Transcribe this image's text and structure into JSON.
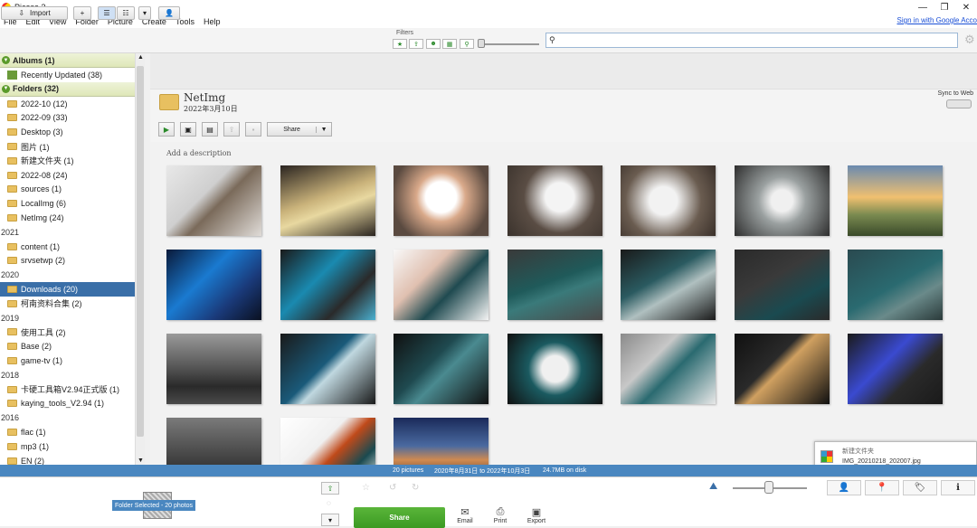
{
  "window": {
    "title": "Picasa 3",
    "controls": [
      "—",
      "❐",
      "✕"
    ]
  },
  "menu": [
    "File",
    "Edit",
    "View",
    "Folder",
    "Picture",
    "Create",
    "Tools",
    "Help"
  ],
  "signin": "Sign in with Google Acco",
  "toolbar": {
    "import_label": "Import",
    "filters_label": "Filters"
  },
  "sidebar": {
    "albums_header": "Albums (1)",
    "albums": [
      {
        "label": "Recently Updated (38)"
      }
    ],
    "folders_header": "Folders (32)",
    "entries": [
      {
        "type": "folder",
        "label": "2022-10 (12)"
      },
      {
        "type": "folder",
        "label": "2022-09 (33)"
      },
      {
        "type": "folder",
        "label": "Desktop (3)"
      },
      {
        "type": "folder",
        "label": "图片 (1)"
      },
      {
        "type": "folder",
        "label": "新建文件夹 (1)"
      },
      {
        "type": "folder",
        "label": "2022-08 (24)"
      },
      {
        "type": "folder",
        "label": "sources (1)"
      },
      {
        "type": "folder",
        "label": "LocalImg (6)"
      },
      {
        "type": "folder",
        "label": "NetImg (24)"
      },
      {
        "type": "year",
        "label": "2021"
      },
      {
        "type": "folder",
        "label": "content (1)"
      },
      {
        "type": "folder",
        "label": "srvsetwp (2)"
      },
      {
        "type": "year",
        "label": "2020"
      },
      {
        "type": "folder",
        "label": "Downloads (20)",
        "selected": true
      },
      {
        "type": "folder",
        "label": "柯南资料合集 (2)"
      },
      {
        "type": "year",
        "label": "2019"
      },
      {
        "type": "folder",
        "label": "使用工具 (2)"
      },
      {
        "type": "folder",
        "label": "Base (2)"
      },
      {
        "type": "folder",
        "label": "game-tv (1)"
      },
      {
        "type": "year",
        "label": "2018"
      },
      {
        "type": "folder",
        "label": "卡硬工具箱V2.94正式版 (1)"
      },
      {
        "type": "folder",
        "label": "kaying_tools_V2.94 (1)"
      },
      {
        "type": "year",
        "label": "2016"
      },
      {
        "type": "folder",
        "label": "flac (1)"
      },
      {
        "type": "folder",
        "label": "mp3 (1)"
      },
      {
        "type": "folder",
        "label": "EN (2)"
      }
    ]
  },
  "folder": {
    "name": "NetImg",
    "date": "2022年3月10日",
    "sync_label": "Sync to Web",
    "share_label": "Share",
    "description_placeholder": "Add a description"
  },
  "photos": [
    {
      "g": "linear-gradient(135deg,#e8e8e8 0%,#cfcfcf 40%,#7a6a5a 55%,#e0dcd8 100%)"
    },
    {
      "g": "linear-gradient(160deg,#2a2420 0%,#c9b27a 45%,#e8d8a0 60%,#2a2420 100%)"
    },
    {
      "g": "radial-gradient(circle at 50% 45%,#ffffff 0 25%,#d9a98a 40%,#5a4a40 80%)"
    },
    {
      "g": "radial-gradient(circle at 55% 45%,#f4f4f4 0 22%,#5a4d44 55%,#3a322c 100%)"
    },
    {
      "g": "radial-gradient(circle at 45% 50%,#f2f2f2 0 22%,#6a5c50 60%,#3a302a 100%)"
    },
    {
      "g": "radial-gradient(circle at 50% 50%,#f0f0f0 0 18%,#9aa0a0 40%,#2e2e2e 100%)"
    },
    {
      "g": "linear-gradient(180deg,#6a8ab0 0%,#f0c070 45%,#7a8a50 70%,#3a4a2a 100%)"
    },
    {
      "g": "linear-gradient(135deg,#0a1a3a 0%,#1a7ad0 40%,#1a3a7a 70%,#0a1020 100%)"
    },
    {
      "g": "linear-gradient(135deg,#1a1a1a 0%,#1a8ab0 40%,#2a2a2a 70%,#4ab0d0 100%)"
    },
    {
      "g": "linear-gradient(135deg,#f8f8f8 0%,#e0c0b0 35%,#1f4a50 60%,#f4f4f4 100%)"
    },
    {
      "g": "linear-gradient(160deg,#3a3a3a 0%,#1f5a5a 45%,#3a7a7a 60%,#4a4a4a 100%)"
    },
    {
      "g": "linear-gradient(150deg,#1a1a1a 0%,#2a5a60 40%,#b0c0c0 60%,#1a1a1a 100%)"
    },
    {
      "g": "linear-gradient(150deg,#2a2a2a 0%,#3a3a3a 40%,#1a4a50 70%,#2a2a2a 100%)"
    },
    {
      "g": "linear-gradient(150deg,#2a4a50 0%,#2a6a70 50%,#6a8a8a 70%,#2a3a3a 100%)"
    },
    {
      "g": "linear-gradient(180deg,#9a9a9a 0%,#5a5a5a 45%,#2a2a2a 75%,#4a4a4a 100%)"
    },
    {
      "g": "linear-gradient(135deg,#1a1a1a 0%,#1a5a7a 45%,#c0d8e0 55%,#1a1a1a 100%)"
    },
    {
      "g": "linear-gradient(135deg,#101010 0%,#1f4a50 40%,#4a8a90 55%,#101010 100%)"
    },
    {
      "g": "radial-gradient(circle at 50% 50%,#f0f0f0 0 22%,#1a5a60 45%,#101010 100%)"
    },
    {
      "g": "linear-gradient(135deg,#8a8a8a 0%,#c8c8c8 35%,#2a6a70 55%,#e8e8e8 100%)"
    },
    {
      "g": "linear-gradient(135deg,#101010 0%,#2a2a2a 40%,#d0a060 50%,#101010 100%)"
    },
    {
      "g": "linear-gradient(135deg,#1a1a1a 0%,#3a4ad0 40%,#2a2a2a 65%,#1a1a1a 100%)"
    },
    {
      "g": "linear-gradient(180deg,#7a7a7a 0%,#4a4a4a 50%,#1a1a1a 100%)"
    },
    {
      "g": "linear-gradient(135deg,#ffffff 0%,#f0f0f0 40%,#c04a1a 55%,#1a4a50 75%,#ffffff 100%)"
    },
    {
      "g": "linear-gradient(180deg,#1a2a5a 0%,#4a6aa0 40%,#d08a50 60%,#1a1a2a 100%)"
    }
  ],
  "status": {
    "count": "20 pictures",
    "range": "2020年8月31日 to 2022年10月3日",
    "size": "24.7MB on disk"
  },
  "notification": {
    "line1": "新建文件夹",
    "line2": "IMG_20210218_202007.jpg"
  },
  "tray": {
    "label": "Folder Selected - 20 photos"
  },
  "bottom": {
    "share_label": "Share",
    "email_label": "Email",
    "print_label": "Print",
    "export_label": "Export"
  },
  "colors": {
    "accent": "#4a87c0",
    "share_green": "#3b9a22",
    "selection": "#3a6fa8"
  }
}
